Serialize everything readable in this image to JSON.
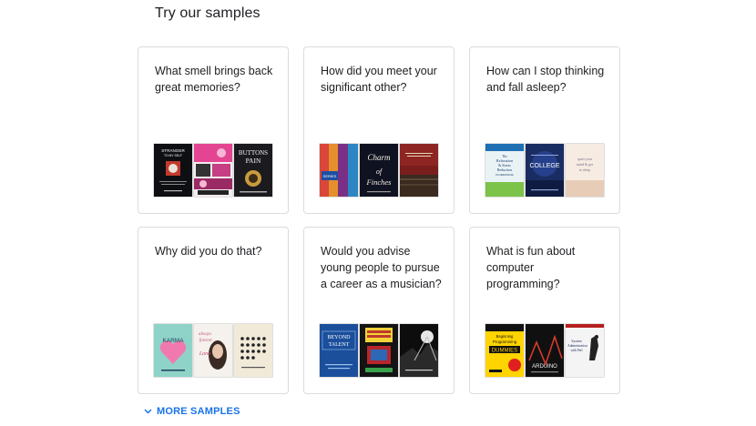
{
  "page": {
    "title": "Try our samples"
  },
  "samples": [
    {
      "question": "What smell brings back great memories?",
      "covers": [
        {
          "kind": "stranger",
          "text": "STRANGER TO MY SELF"
        },
        {
          "kind": "pinkcollage"
        },
        {
          "kind": "buttons",
          "text": "BUTTONS & PAIN"
        }
      ]
    },
    {
      "question": "How did you meet your significant other?",
      "covers": [
        {
          "kind": "seriesbox",
          "text": "SERIES"
        },
        {
          "kind": "charm",
          "text": "A Charm of Finches"
        },
        {
          "kind": "redgold"
        }
      ]
    },
    {
      "question": "How can I stop thinking and fall asleep?",
      "covers": [
        {
          "kind": "relaxation",
          "text": "The Relaxation & Stress Reduction WORKBOOK"
        },
        {
          "kind": "college",
          "text": "COLLEGE"
        },
        {
          "kind": "quietmind",
          "text": "quiet your mind & get to sleep"
        }
      ]
    },
    {
      "question": "Why did you do that?",
      "covers": [
        {
          "kind": "karma",
          "text": "KARMA"
        },
        {
          "kind": "lana",
          "text": "Lana"
        },
        {
          "kind": "dots"
        }
      ]
    },
    {
      "question": "Would you advise young people to pursue a career as a musician?",
      "covers": [
        {
          "kind": "beyond",
          "text": "BEYOND TALENT"
        },
        {
          "kind": "touring"
        },
        {
          "kind": "concert"
        }
      ]
    },
    {
      "question": "What is fun about computer programming?",
      "covers": [
        {
          "kind": "dummies",
          "text": "Programming DUMMIES"
        },
        {
          "kind": "arduino",
          "text": "ARDUINO"
        },
        {
          "kind": "perl",
          "text": "System Administration with Perl"
        }
      ]
    }
  ],
  "more_samples": {
    "label": "MORE SAMPLES",
    "icon": "chevron-down-icon"
  },
  "colors": {
    "accent": "#1a73e8",
    "border": "#dadce0",
    "text": "#202124"
  }
}
